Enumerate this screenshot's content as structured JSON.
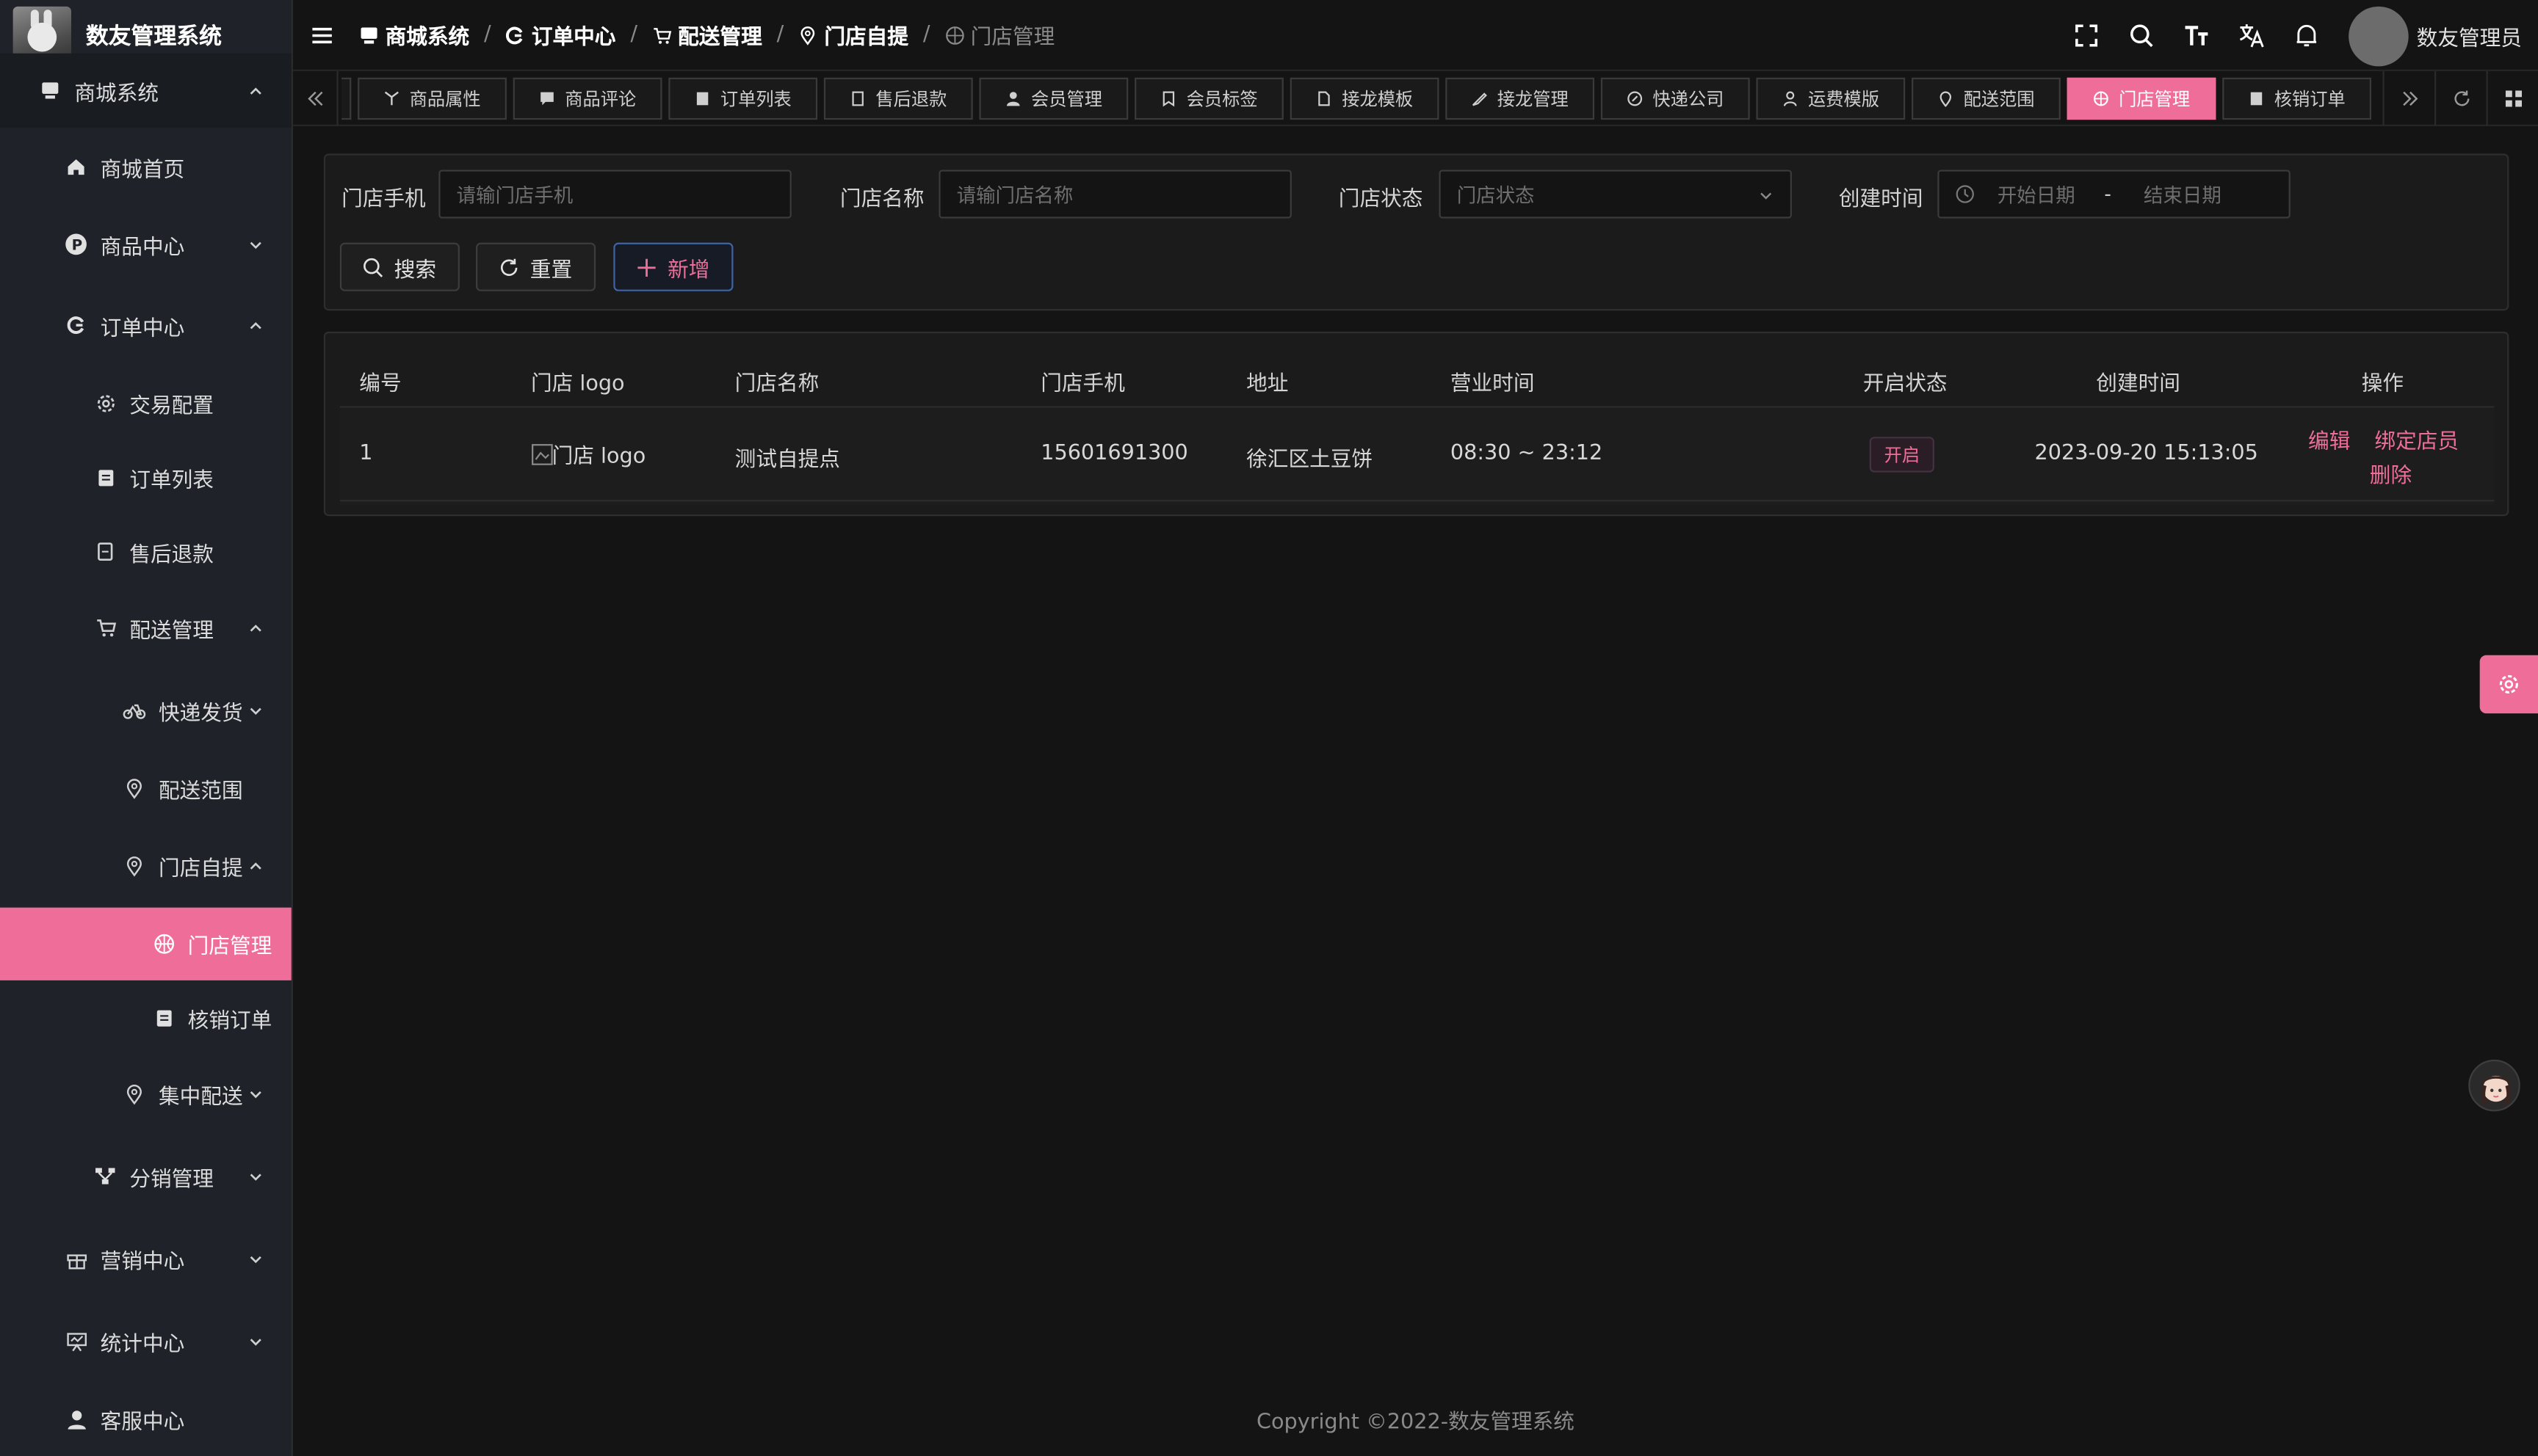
{
  "app": {
    "title": "数友管理系统"
  },
  "sidebar": {
    "top_item": "商城系统",
    "items": [
      {
        "label": "商城首页"
      },
      {
        "label": "商品中心"
      },
      {
        "label": "订单中心"
      },
      {
        "label": "交易配置"
      },
      {
        "label": "订单列表"
      },
      {
        "label": "售后退款"
      },
      {
        "label": "配送管理"
      },
      {
        "label": "快递发货"
      },
      {
        "label": "配送范围"
      },
      {
        "label": "门店自提"
      },
      {
        "label": "门店管理"
      },
      {
        "label": "核销订单"
      },
      {
        "label": "集中配送"
      },
      {
        "label": "分销管理"
      },
      {
        "label": "营销中心"
      },
      {
        "label": "统计中心"
      },
      {
        "label": "客服中心"
      }
    ]
  },
  "header": {
    "breadcrumb": [
      "商城系统",
      "订单中心",
      "配送管理",
      "门店自提",
      "门店管理"
    ],
    "username": "数友管理员"
  },
  "tags": [
    {
      "label": "商品属性"
    },
    {
      "label": "商品评论"
    },
    {
      "label": "订单列表"
    },
    {
      "label": "售后退款"
    },
    {
      "label": "会员管理"
    },
    {
      "label": "会员标签"
    },
    {
      "label": "接龙模板"
    },
    {
      "label": "接龙管理"
    },
    {
      "label": "快递公司"
    },
    {
      "label": "运费模版"
    },
    {
      "label": "配送范围"
    },
    {
      "label": "门店管理"
    },
    {
      "label": "核销订单"
    }
  ],
  "search": {
    "phone_label": "门店手机",
    "phone_placeholder": "请输门店手机",
    "name_label": "门店名称",
    "name_placeholder": "请输门店名称",
    "status_label": "门店状态",
    "status_placeholder": "门店状态",
    "created_label": "创建时间",
    "start_placeholder": "开始日期",
    "range_sep": "-",
    "end_placeholder": "结束日期",
    "search_button": "搜索",
    "reset_button": "重置",
    "add_button": "新增"
  },
  "table": {
    "columns": [
      "编号",
      "门店 logo",
      "门店名称",
      "门店手机",
      "地址",
      "营业时间",
      "开启状态",
      "创建时间",
      "操作"
    ],
    "rows": [
      {
        "id": "1",
        "logo_alt": "门店 logo",
        "name": "测试自提点",
        "phone": "15601691300",
        "address": "徐汇区土豆饼",
        "hours": "08:30 ~ 23:12",
        "status": "开启",
        "created": "2023-09-20 15:13:05",
        "actions": {
          "edit": "编辑",
          "bind": "绑定店员",
          "delete": "删除"
        }
      }
    ]
  },
  "footer": {
    "copyright": "Copyright ©2022-数友管理系统"
  },
  "colors": {
    "accent": "#ef6e99",
    "sidebar_bg": "#1f2329",
    "page_bg": "#141414"
  },
  "icons": {
    "header_tools": [
      "fullscreen-icon",
      "search-icon",
      "font-size-icon",
      "translate-icon",
      "bell-icon"
    ],
    "tag_tools": [
      "refresh-icon",
      "grid-icon"
    ]
  }
}
